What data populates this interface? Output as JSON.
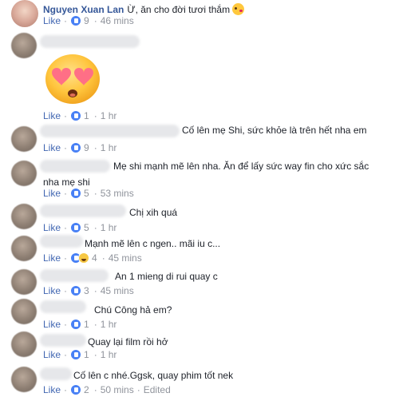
{
  "comments": [
    {
      "name": "Nguyen Xuan Lan",
      "text": "Ừ, ăn cho đời tươi thắm",
      "has_emoji": true,
      "like_label": "Like",
      "reactions": "like",
      "count": "9",
      "time": "46 mins"
    },
    {
      "name": "",
      "text": "",
      "sticker": "heart-eyes-sticker",
      "like_label": "Like",
      "reactions": "like",
      "count": "1",
      "time": "1 hr"
    },
    {
      "name": "",
      "text": "Cố lên mẹ Shi, sức khỏe là trên hết nha em",
      "like_label": "Like",
      "reactions": "like",
      "count": "9",
      "time": "1 hr"
    },
    {
      "name": "",
      "text_line1": "Mẹ shi mạnh mẽ lên nha. Ăn để lấy sức way fin cho xức sắc",
      "text_line2": "nha mẹ shi",
      "like_label": "Like",
      "reactions": "like",
      "count": "5",
      "time": "53 mins"
    },
    {
      "name": "",
      "text": "Chị xih quá",
      "like_label": "Like",
      "reactions": "like",
      "count": "5",
      "time": "1 hr"
    },
    {
      "name": "",
      "text": "Mạnh mẽ lên c ngen.. mãi iu c...",
      "like_label": "Like",
      "reactions": "like+haha",
      "count": "4",
      "time": "45 mins"
    },
    {
      "name": "",
      "text": "An 1 mieng di rui quay c",
      "like_label": "Like",
      "reactions": "like",
      "count": "3",
      "time": "45 mins"
    },
    {
      "name": "",
      "text": "Chú Công hả em?",
      "like_label": "Like",
      "reactions": "like",
      "count": "1",
      "time": "1 hr"
    },
    {
      "name": "",
      "text": "Quay lại film rồi hở",
      "like_label": "Like",
      "reactions": "like",
      "count": "1",
      "time": "1 hr"
    },
    {
      "name": "",
      "text": "Cố lên c nhé.Ggsk, quay phim tốt nek",
      "like_label": "Like",
      "reactions": "like",
      "count": "2",
      "time": "50 mins",
      "edited": "Edited"
    }
  ],
  "colors": {
    "link": "#365899",
    "like": "#4267b2",
    "meta": "#90949c",
    "text": "#1d2129"
  }
}
